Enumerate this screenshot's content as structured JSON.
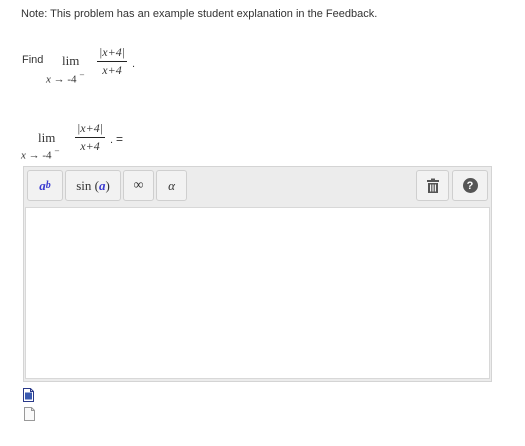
{
  "note": "Note: This problem has an example student explanation in the Feedback.",
  "problem": {
    "find_label": "Find",
    "lim": "lim",
    "approach_var": "x",
    "approach_arrow": "→",
    "approach_value": "-4",
    "approach_side": "−",
    "numerator": "|x+4|",
    "denominator": "x+4",
    "period": "."
  },
  "answer_line": {
    "lim": "lim",
    "approach_var": "x",
    "approach_arrow": "→",
    "approach_value": "-4",
    "approach_side": "−",
    "numerator": "|x+4|",
    "denominator": "x+4",
    "period": ".",
    "equals": "="
  },
  "toolbar": {
    "superscript_base": "a",
    "superscript_exp": "b",
    "sin_fn": "sin",
    "sin_arg": "a",
    "infinity": "∞",
    "alpha": "α",
    "trash_icon": "trash-icon",
    "help_icon": "question-icon",
    "help_glyph": "?"
  },
  "editor": {
    "value": ""
  },
  "colors": {
    "accent": "#3a3ad0",
    "toolbar_bg": "#ececec"
  }
}
